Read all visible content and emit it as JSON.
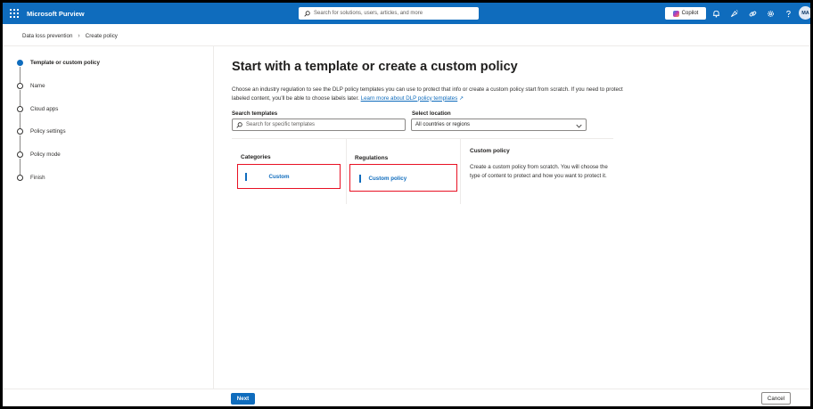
{
  "topbar": {
    "app_name": "Microsoft Purview",
    "search_placeholder": "Search for solutions, users, articles, and more",
    "copilot_label": "Copilot",
    "avatar_initials": "MA",
    "icons": [
      "waffle-icon",
      "search-icon",
      "copilot-icon",
      "bell-icon",
      "megaphone-icon",
      "link-icon",
      "gear-icon",
      "help-icon"
    ]
  },
  "breadcrumb": {
    "items": [
      "Data loss prevention",
      "Create policy"
    ]
  },
  "steps": {
    "items": [
      {
        "label": "Template or custom policy",
        "active": true
      },
      {
        "label": "Name",
        "active": false
      },
      {
        "label": "Cloud apps",
        "active": false
      },
      {
        "label": "Policy settings",
        "active": false
      },
      {
        "label": "Policy mode",
        "active": false
      },
      {
        "label": "Finish",
        "active": false
      }
    ]
  },
  "main": {
    "title": "Start with a template or create a custom policy",
    "description": "Choose an industry regulation to see the DLP policy templates you can use to protect that info or create a custom policy start from scratch. If you need to protect labeled content, you'll be able to choose labels later.",
    "learn_more_link": "Learn more about DLP policy templates",
    "search_label": "Search templates",
    "search_placeholder": "Search for specific templates",
    "location_label": "Select location",
    "location_value": "All countries or regions",
    "categories_header": "Categories",
    "category_selected": "Custom",
    "regulations_header": "Regulations",
    "regulation_selected": "Custom policy",
    "detail_title": "Custom policy",
    "detail_description": "Create a custom policy from scratch. You will choose the type of content to protect and how you want to protect it."
  },
  "footer": {
    "next_label": "Next",
    "cancel_label": "Cancel"
  },
  "colors": {
    "brand_blue": "#0f6cbd",
    "highlight_red": "#e81123"
  }
}
